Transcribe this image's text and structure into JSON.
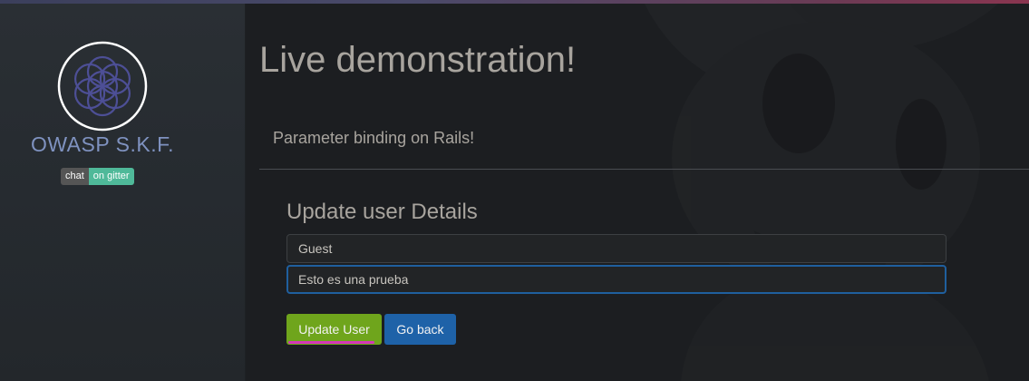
{
  "sidebar": {
    "brand": "OWASP S.K.F.",
    "badge": {
      "left": "chat",
      "right": "on gitter"
    }
  },
  "main": {
    "title": "Live demonstration!",
    "subtitle": "Parameter binding on Rails!",
    "form": {
      "heading": "Update user Details",
      "fields": [
        {
          "value": "Guest"
        },
        {
          "value": "Esto es una prueba"
        }
      ],
      "update_label": "Update User",
      "back_label": "Go back"
    }
  },
  "colors": {
    "accent_green": "#6fa51c",
    "accent_blue": "#1e62a8",
    "brand_text": "#7f92c0",
    "focus_border": "#1f5f9e",
    "annotation_underline": "#d437b8"
  }
}
